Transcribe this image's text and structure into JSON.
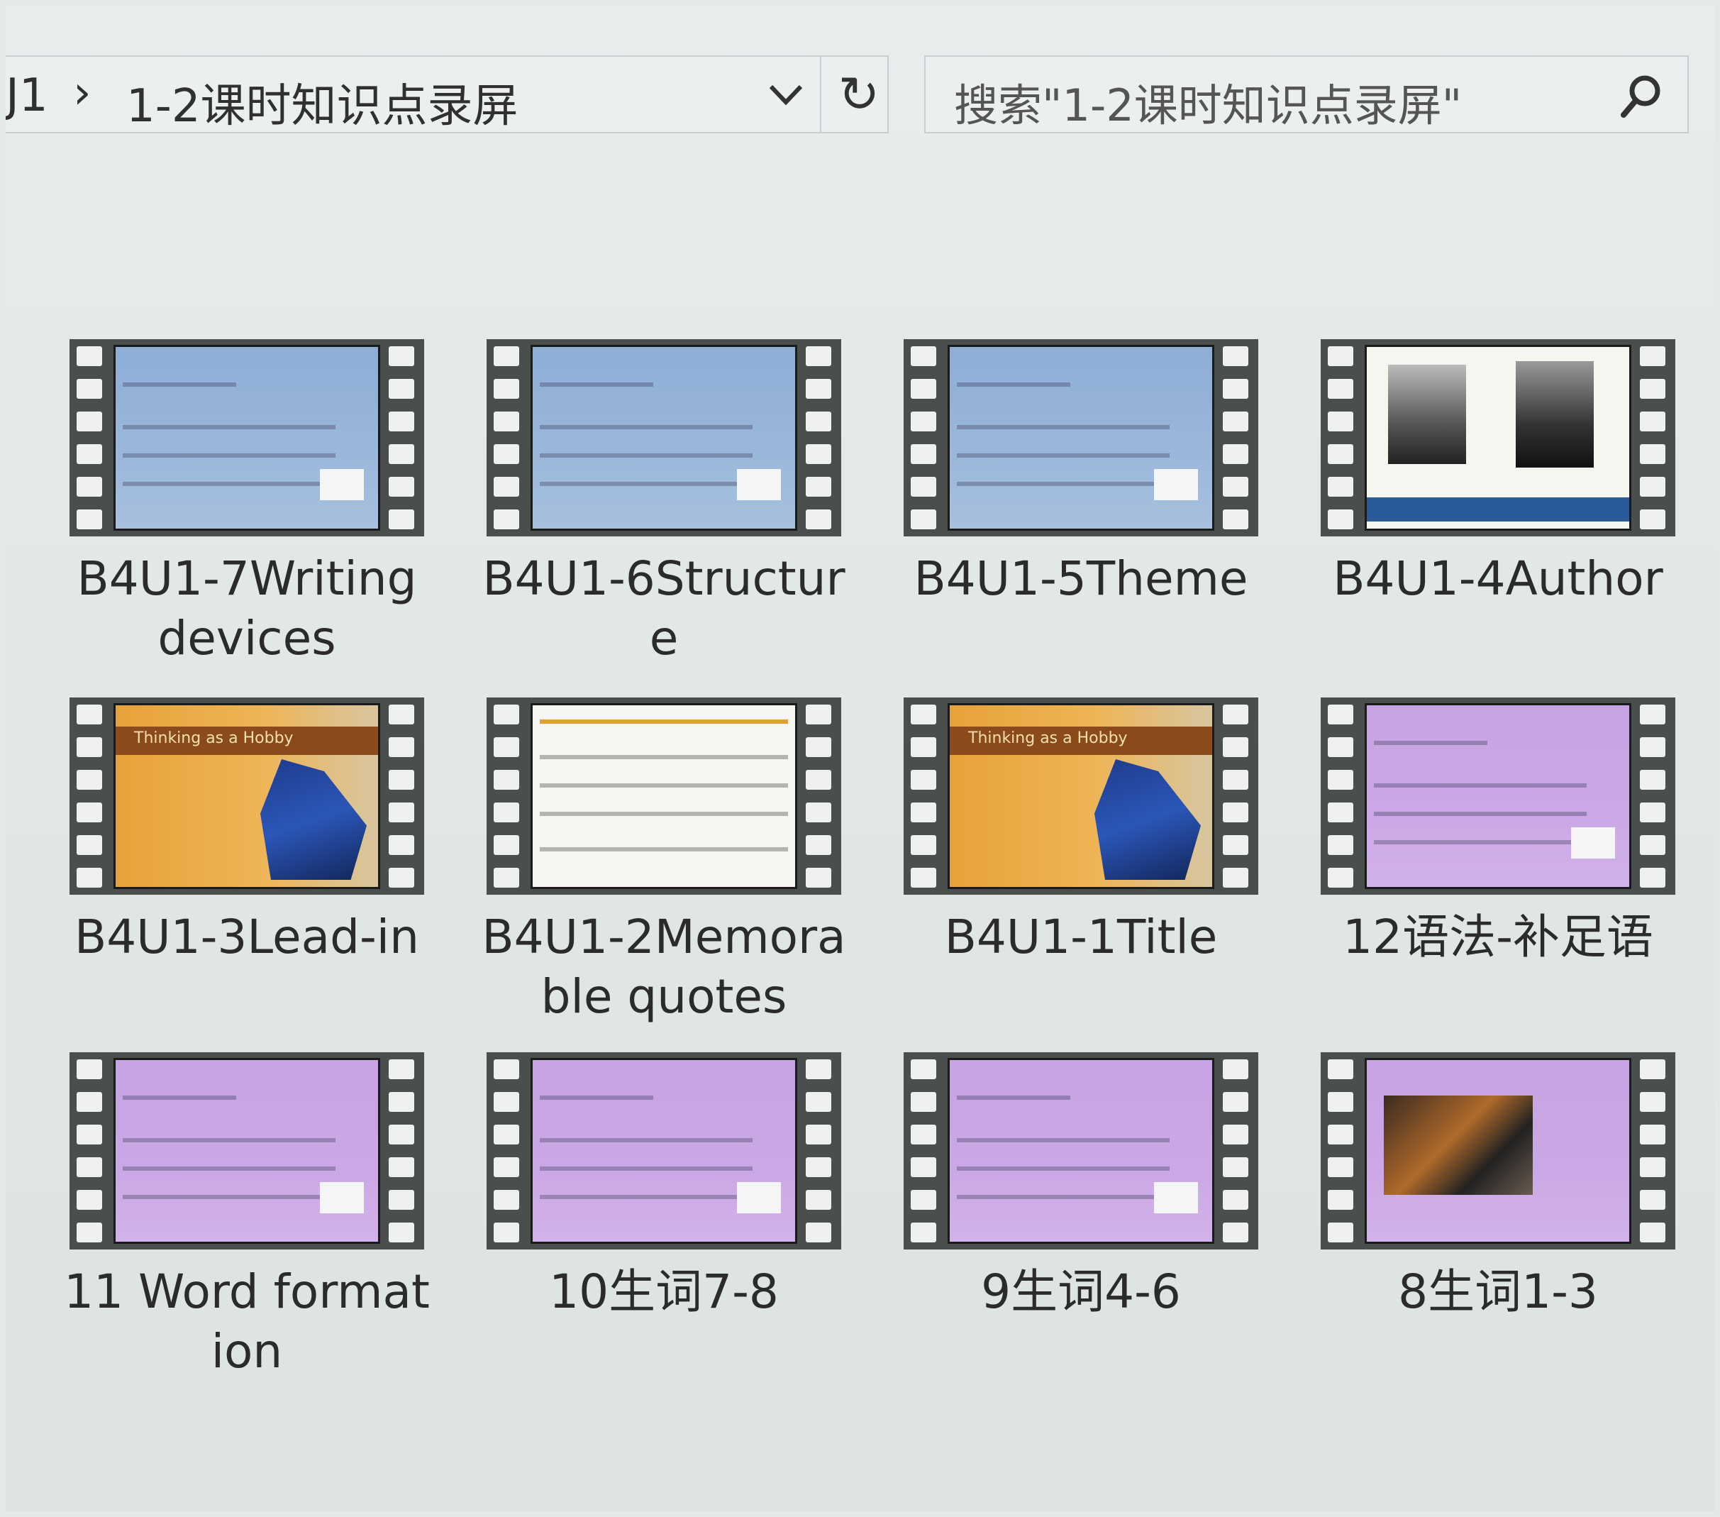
{
  "address_bar": {
    "prev_crumb": "J1",
    "separator": "›",
    "current_folder": "1-2课时知识点录屏",
    "refresh_glyph": "↻"
  },
  "search": {
    "placeholder": "搜索\"1-2课时知识点录屏\"",
    "icon": "search-icon"
  },
  "items": [
    {
      "label": "B4U1-7Writing devices",
      "thumb": "blue"
    },
    {
      "label": "B4U1-6Structure",
      "thumb": "blue"
    },
    {
      "label": "B4U1-5Theme",
      "thumb": "blue"
    },
    {
      "label": "B4U1-4Author",
      "thumb": "photo"
    },
    {
      "label": "B4U1-3Lead-in",
      "thumb": "orange",
      "thumb_title": "Thinking as a Hobby"
    },
    {
      "label": "B4U1-2Memorable quotes",
      "thumb": "white"
    },
    {
      "label": "B4U1-1Title",
      "thumb": "orange",
      "thumb_title": "Thinking as a Hobby"
    },
    {
      "label": "12语法-补足语",
      "thumb": "purple"
    },
    {
      "label": "11 Word formation",
      "thumb": "purple"
    },
    {
      "label": "10生词7-8",
      "thumb": "purple"
    },
    {
      "label": "9生词4-6",
      "thumb": "purple"
    },
    {
      "label": "8生词1-3",
      "thumb": "purple-photo"
    }
  ]
}
